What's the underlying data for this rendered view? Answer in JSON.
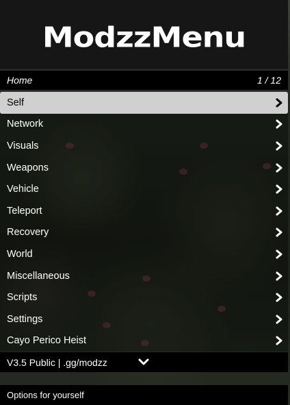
{
  "header": {
    "logo_text": "ModzzMenu"
  },
  "subheader": {
    "title": "Home",
    "page_indicator": "1 / 12"
  },
  "menu": {
    "selected_index": 0,
    "items": [
      {
        "label": "Self"
      },
      {
        "label": "Network"
      },
      {
        "label": "Visuals"
      },
      {
        "label": "Weapons"
      },
      {
        "label": "Vehicle"
      },
      {
        "label": "Teleport"
      },
      {
        "label": "Recovery"
      },
      {
        "label": "World"
      },
      {
        "label": "Miscellaneous"
      },
      {
        "label": "Scripts"
      },
      {
        "label": "Settings"
      },
      {
        "label": "Cayo Perico Heist"
      }
    ]
  },
  "footer": {
    "version_text": "V3.5 Public | .gg/modzz",
    "scroll_icon": "chevron-down-icon"
  },
  "description": {
    "text": "Options for yourself"
  },
  "colors": {
    "header_bg": "#161616",
    "bar_bg": "#000000",
    "selected_bg": "#d0d0d0",
    "text": "#ffffff",
    "selected_text": "#000000"
  }
}
